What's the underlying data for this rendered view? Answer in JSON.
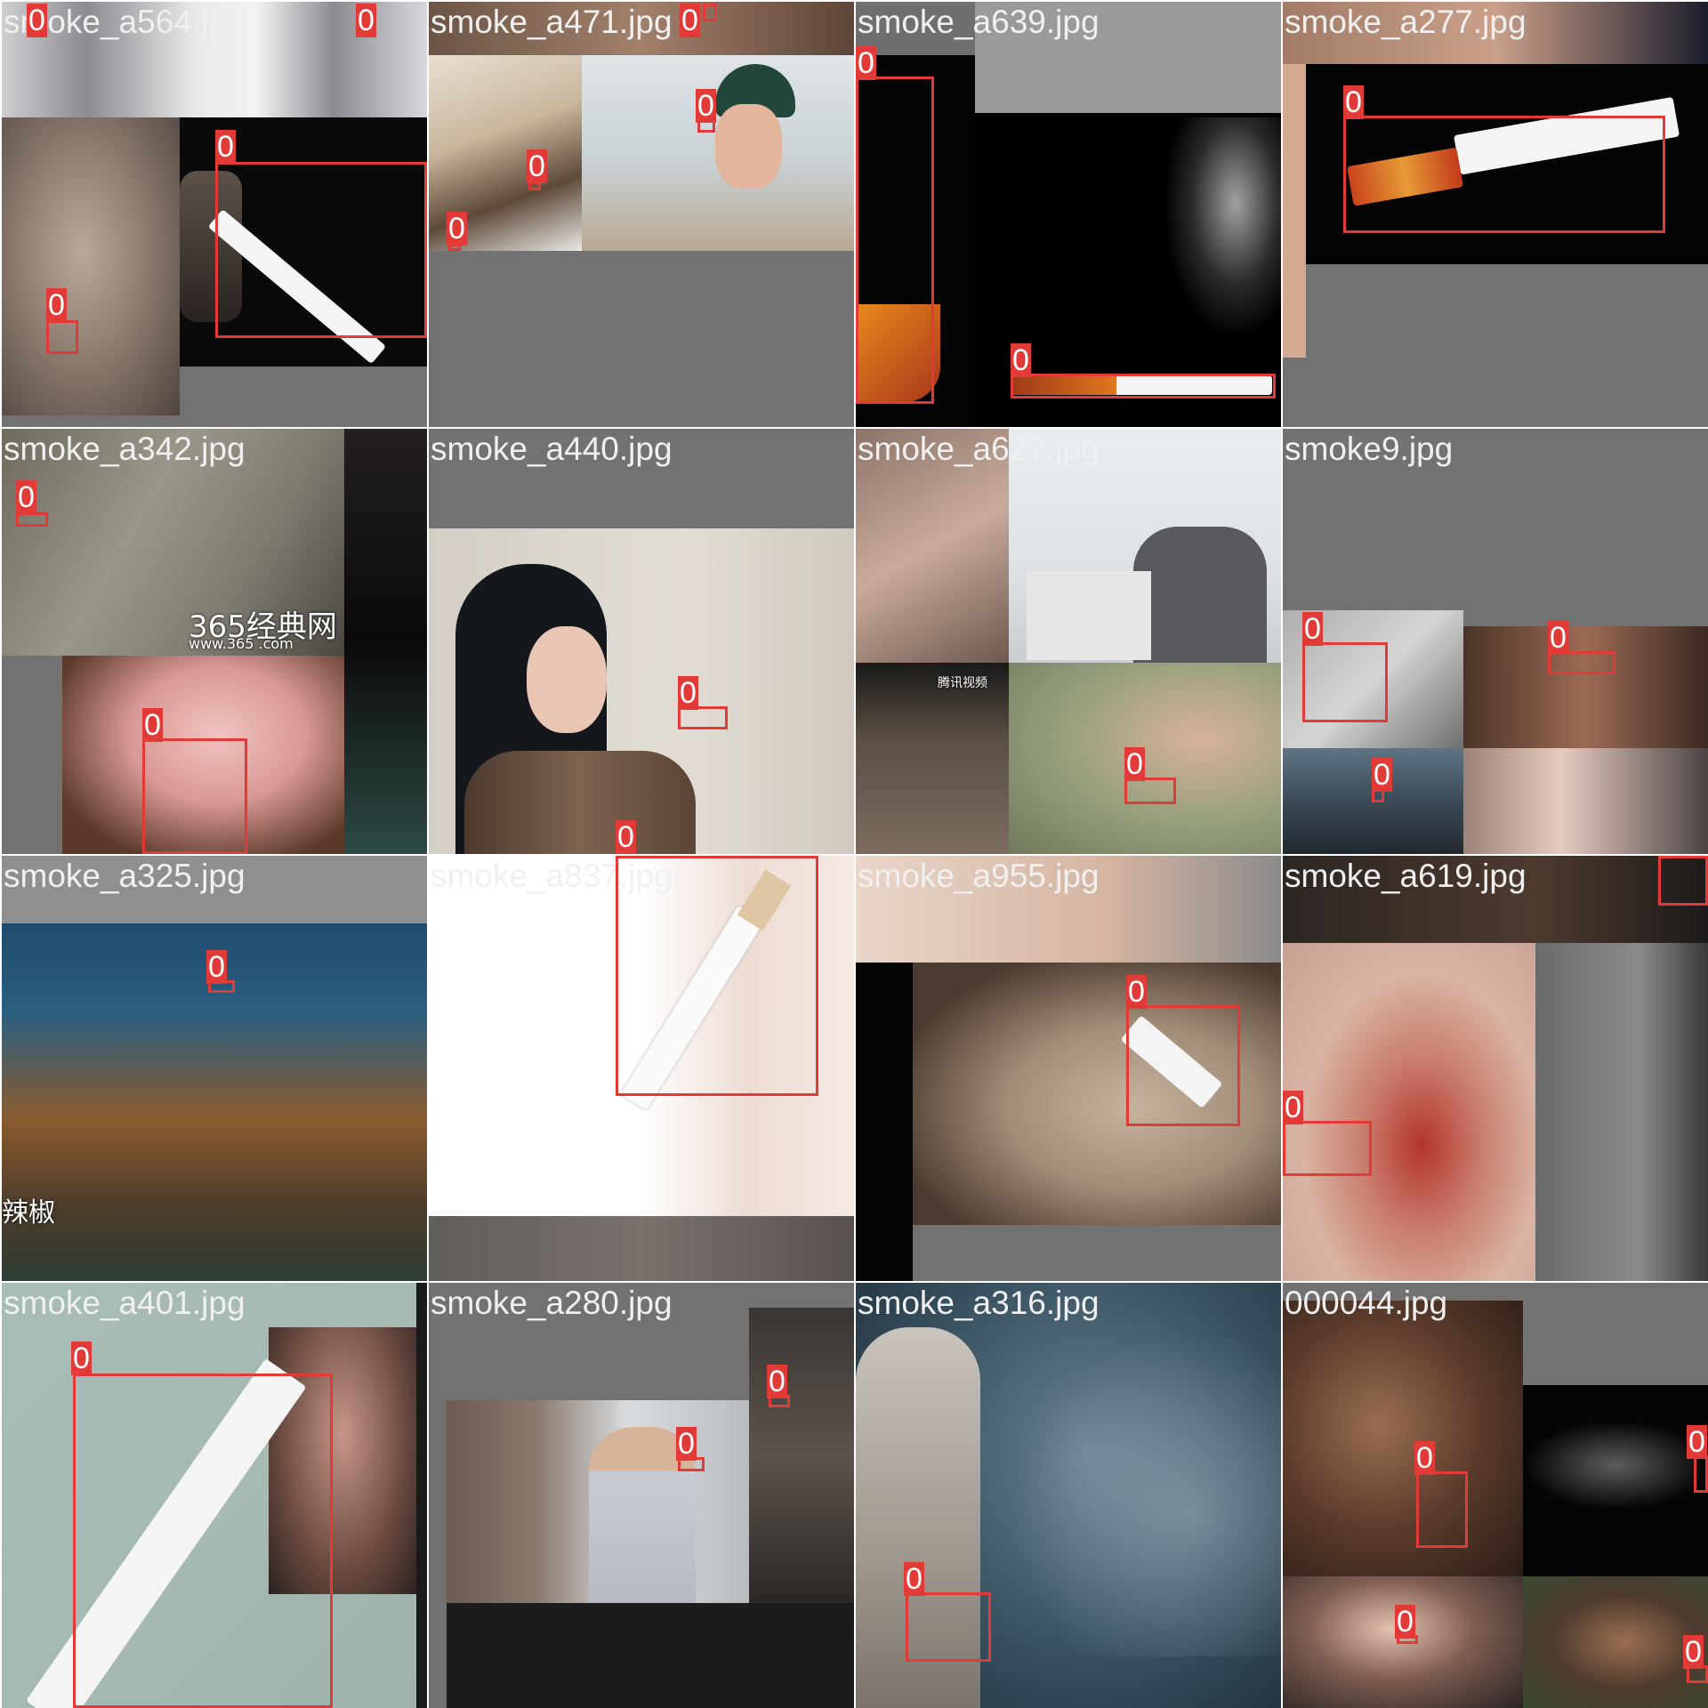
{
  "label_class": "0",
  "colors": {
    "box": "#e23b37",
    "filename_text": "#f0f0f0",
    "letterbox": "#727272"
  },
  "tiles": [
    {
      "filename": "smoke_a564.jpg"
    },
    {
      "filename": "smoke_a471.jpg"
    },
    {
      "filename": "smoke_a639.jpg"
    },
    {
      "filename": "smoke_a277.jpg"
    },
    {
      "filename": "smoke_a342.jpg",
      "watermark": "365经典网",
      "watermark_url": "www.365 .com"
    },
    {
      "filename": "smoke_a440.jpg"
    },
    {
      "filename": "smoke_a627.jpg",
      "watermark": "腾讯视频"
    },
    {
      "filename": "smoke9.jpg"
    },
    {
      "filename": "smoke_a325.jpg",
      "watermark": "辣椒"
    },
    {
      "filename": "smoke_a837.jpg"
    },
    {
      "filename": "smoke_a955.jpg"
    },
    {
      "filename": "smoke_a619.jpg"
    },
    {
      "filename": "smoke_a401.jpg"
    },
    {
      "filename": "smoke_a280.jpg"
    },
    {
      "filename": "smoke_a316.jpg"
    },
    {
      "filename": "000044.jpg"
    }
  ]
}
